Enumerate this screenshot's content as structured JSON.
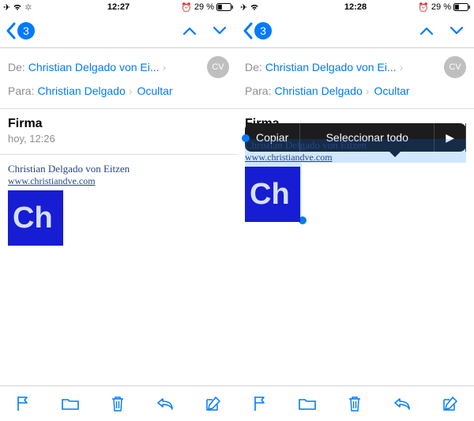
{
  "status": {
    "time_left": "12:27",
    "time_right": "12:28",
    "battery": "29 %"
  },
  "nav": {
    "badge": "3"
  },
  "headers": {
    "from_key": "De:",
    "from_value": "Christian Delgado von Ei...",
    "to_key": "Para:",
    "to_value": "Christian Delgado",
    "avatar": "CV",
    "hide": "Ocultar"
  },
  "subject": "Firma",
  "timestamp": "hoy, 12:26",
  "signature": {
    "name": "Christian Delgado von Eitzen",
    "url": "www.christiandve.com",
    "logo_text": "Ch"
  },
  "callout": {
    "copy": "Copiar",
    "select_all": "Seleccionar todo",
    "more": "▶"
  }
}
